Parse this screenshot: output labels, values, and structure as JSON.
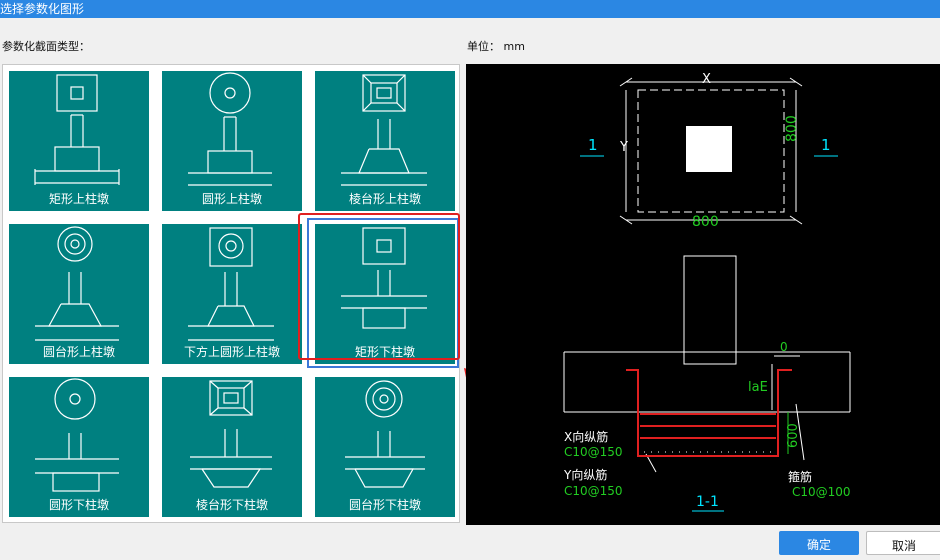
{
  "window": {
    "title": "选择参数化图形"
  },
  "labels": {
    "section_type": "参数化截面类型：",
    "unit": "单位：  mm"
  },
  "gallery": {
    "items": [
      {
        "label": "矩形上柱墩"
      },
      {
        "label": "圆形上柱墩"
      },
      {
        "label": "棱台形上柱墩"
      },
      {
        "label": "圆台形上柱墩"
      },
      {
        "label": "下方上圆形上柱墩"
      },
      {
        "label": "矩形下柱墩"
      },
      {
        "label": "圆形下柱墩"
      },
      {
        "label": "棱台形下柱墩"
      },
      {
        "label": "圆台形下柱墩"
      }
    ],
    "selected_index": 5
  },
  "preview": {
    "plan": {
      "dim_x": "X",
      "dim_y": "Y",
      "dim_width": "800",
      "dim_height": "800",
      "section_left": "1",
      "section_right": "1"
    },
    "section": {
      "dim_top": "0",
      "dim_lae": "laE",
      "dim_height": "600",
      "label_x_rebar": "X向纵筋",
      "value_x_rebar": "C10@150",
      "label_y_rebar": "Y向纵筋",
      "value_y_rebar": "C10@150",
      "label_stirrup": "箍筋",
      "value_stirrup": "C10@100",
      "title": "1-1"
    },
    "colors": {
      "dim_white": "#ffffff",
      "dim_green": "#22cc22",
      "accent_cyan": "#00e5ff",
      "rebar_red": "#e02020"
    }
  },
  "buttons": {
    "ok": "确定",
    "cancel": "取消"
  }
}
